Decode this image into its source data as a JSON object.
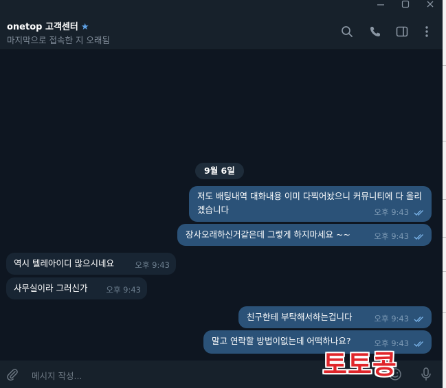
{
  "header": {
    "title": "onetop 고객센터",
    "status": "마지막으로 접속한 지 오래됨"
  },
  "icons": [
    "minimize-icon",
    "maximize-icon",
    "close-icon",
    "star-icon",
    "search-icon",
    "phone-icon",
    "sidebar-toggle-icon",
    "more-icon",
    "attach-icon",
    "emoji-icon",
    "microphone-icon",
    "double-check-icon"
  ],
  "colors": {
    "background": "#0e1621",
    "header": "#17212b",
    "outgoing": "#2b5278",
    "incoming": "#182533",
    "accent": "#5fa3e8"
  },
  "chat": {
    "date": "9월 6일",
    "messages": [
      {
        "dir": "out",
        "text": "저도 배팅내역 대화내용 이미 다찍어놨으니 커뮤니티에 다 올리겠습니다",
        "time": "오후 9:43",
        "read": true
      },
      {
        "dir": "out",
        "text": "장사오래하신거같은데 그렇게 하지마세요 ~~",
        "time": "오후 9:43",
        "read": true
      },
      {
        "dir": "in",
        "text": "역시 텔레아이디 많으시네요",
        "time": "오후 9:43"
      },
      {
        "dir": "in",
        "text": "사무실이라 그러신가",
        "time": "오후 9:43"
      },
      {
        "dir": "out",
        "text": "친구한테 부탁해서하는겁니다",
        "time": "오후 9:43",
        "read": true
      },
      {
        "dir": "out",
        "text": "말고 연락할 방법이없는데 어떡하나요?",
        "time": "오후 9:43",
        "read": true
      }
    ]
  },
  "composer": {
    "placeholder": "메시지 작성..."
  },
  "watermark": "토토콩"
}
